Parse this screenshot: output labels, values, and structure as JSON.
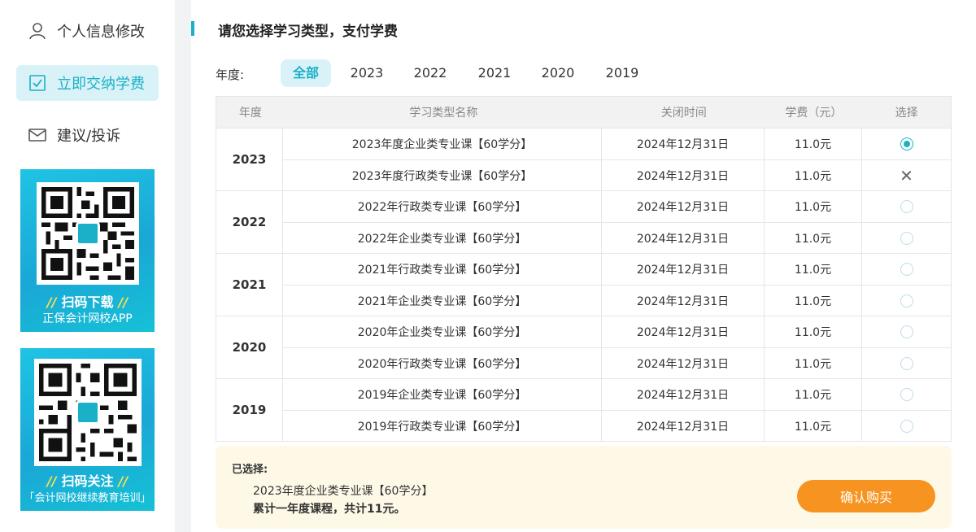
{
  "sidebar": {
    "items": [
      {
        "label": "个人信息修改",
        "icon": "user-icon",
        "active": false
      },
      {
        "label": "立即交纳学费",
        "icon": "checkbox-icon",
        "active": true
      },
      {
        "label": "建议/投诉",
        "icon": "mail-icon",
        "active": false
      }
    ],
    "promos": [
      {
        "slash": "//",
        "title": "扫码下载",
        "subtitle": "正保会计网校APP"
      },
      {
        "slash": "//",
        "title": "扫码关注",
        "subtitle": "「会计网校继续教育培训」"
      }
    ]
  },
  "main": {
    "heading": "请您选择学习类型，支付学费",
    "year_filter": {
      "label": "年度:",
      "tabs": [
        "全部",
        "2023",
        "2022",
        "2021",
        "2020",
        "2019"
      ],
      "active": "全部"
    },
    "table": {
      "headers": [
        "年度",
        "学习类型名称",
        "关闭时间",
        "学费（元）",
        "选择"
      ],
      "groups": [
        {
          "year": "2023",
          "rows": [
            {
              "name": "2023年度企业类专业课【60学分】",
              "close": "2024年12月31日",
              "fee": "11.0元",
              "select": "selected"
            },
            {
              "name": "2023年度行政类专业课【60学分】",
              "close": "2024年12月31日",
              "fee": "11.0元",
              "select": "disabled"
            }
          ]
        },
        {
          "year": "2022",
          "rows": [
            {
              "name": "2022年行政类专业课【60学分】",
              "close": "2024年12月31日",
              "fee": "11.0元",
              "select": "none"
            },
            {
              "name": "2022年企业类专业课【60学分】",
              "close": "2024年12月31日",
              "fee": "11.0元",
              "select": "none"
            }
          ]
        },
        {
          "year": "2021",
          "rows": [
            {
              "name": "2021年行政类专业课【60学分】",
              "close": "2024年12月31日",
              "fee": "11.0元",
              "select": "none"
            },
            {
              "name": "2021年企业类专业课【60学分】",
              "close": "2024年12月31日",
              "fee": "11.0元",
              "select": "none"
            }
          ]
        },
        {
          "year": "2020",
          "rows": [
            {
              "name": "2020年企业类专业课【60学分】",
              "close": "2024年12月31日",
              "fee": "11.0元",
              "select": "none"
            },
            {
              "name": "2020年行政类专业课【60学分】",
              "close": "2024年12月31日",
              "fee": "11.0元",
              "select": "none"
            }
          ]
        },
        {
          "year": "2019",
          "rows": [
            {
              "name": "2019年企业类专业课【60学分】",
              "close": "2024年12月31日",
              "fee": "11.0元",
              "select": "none"
            },
            {
              "name": "2019年行政类专业课【60学分】",
              "close": "2024年12月31日",
              "fee": "11.0元",
              "select": "none"
            }
          ]
        }
      ]
    },
    "summary": {
      "label": "已选择:",
      "course": "2023年度企业类专业课【60学分】",
      "total": "累计一年度课程，共计11元。",
      "button": "确认购买"
    }
  },
  "colors": {
    "accent": "#1ab0c8",
    "accent_light": "#d9f2f7",
    "button": "#f79421",
    "summary_bg": "#fef9e7"
  }
}
